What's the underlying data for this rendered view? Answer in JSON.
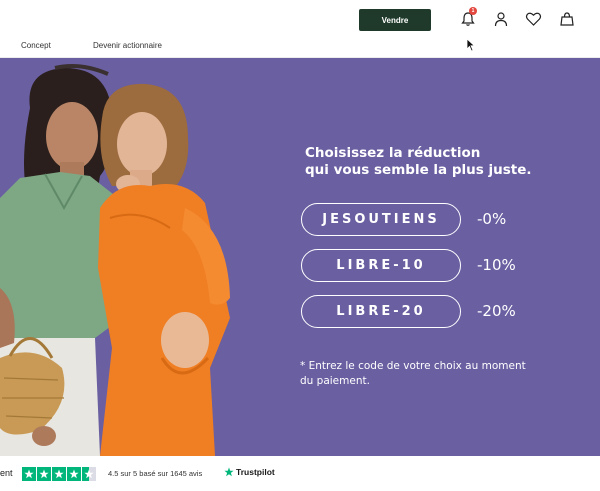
{
  "header": {
    "sell_button": "Vendre",
    "notification_count": "1",
    "nav": [
      "Concept",
      "Devenir actionnaire"
    ]
  },
  "hero": {
    "headline_line1": "Choisissez la réduction",
    "headline_line2": "qui vous semble la plus juste.",
    "codes": [
      {
        "code": "JESOUTIENS",
        "discount": "-0%"
      },
      {
        "code": "LIBRE-10",
        "discount": "-10%"
      },
      {
        "code": "LIBRE-20",
        "discount": "-20%"
      }
    ],
    "note": "* Entrez le code de votre choix au moment du paiement."
  },
  "trust": {
    "lead": "ent",
    "rating": 4.5,
    "text": "4.5 sur 5 basé sur 1645 avis",
    "brand": "Trustpilot"
  },
  "colors": {
    "hero_bg": "#6a5fa1",
    "button_bg": "#1f3a2b",
    "trustpilot_green": "#00b67a",
    "badge_red": "#e2463c"
  }
}
